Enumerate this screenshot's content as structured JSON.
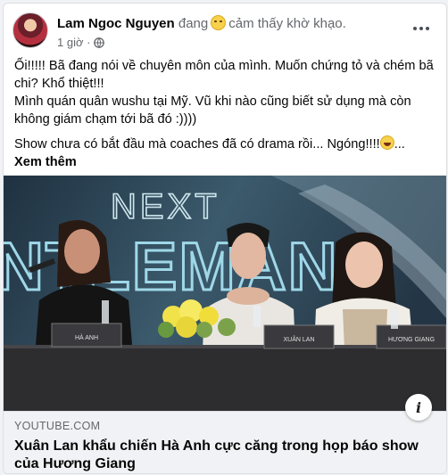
{
  "post": {
    "author": "Lam Ngoc Nguyen",
    "feeling_prefix": "đang",
    "feeling_text": "cảm thấy khờ khạo.",
    "time": "1 giờ ·",
    "paragraph1": "Ối!!!!! Bã đang nói về chuyên môn của mình.  Muốn chứng tỏ và chém bã chi?   Khổ thiệt!!!",
    "paragraph1b": "Mình quán quân wushu tại Mỹ.  Vũ khi nào cũng biết sử dụng mà còn không giám chạm tới bã đó :))))",
    "paragraph2": "Show chưa có bắt đầu mà coaches đã có drama rồi...  Ngóng!!!!",
    "ellipsis": "...",
    "see_more": "Xem thêm"
  },
  "media": {
    "backdrop_text_top": "NEXT",
    "backdrop_text_main": "NTLEMAN",
    "nameplates": [
      "HÀ ANH",
      "XUÂN LAN",
      "HƯƠNG GIANG"
    ]
  },
  "link": {
    "domain": "YOUTUBE.COM",
    "title": "Xuân Lan khẩu chiến Hà Anh cực căng trong họp báo show của Hương Giang",
    "info_label": "i"
  },
  "icons": [
    "globe-icon",
    "more-icon",
    "info-icon",
    "smiley-emoji",
    "laughing-emoji"
  ]
}
